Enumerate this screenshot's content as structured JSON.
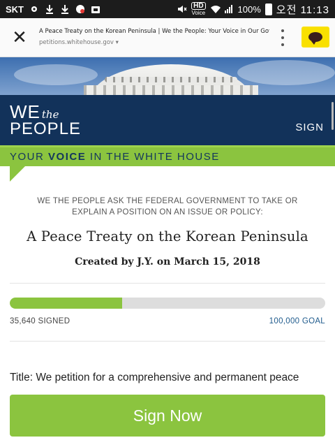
{
  "status_bar": {
    "carrier": "SKT",
    "hd_label": "HD",
    "voice_label": "Voice",
    "battery": "100%",
    "time": "오전 11:13"
  },
  "browser": {
    "page_title": "A Peace Treaty on the Korean Peninsula | We the People: Your Voice in Our Government",
    "domain": "petitions.whitehouse.gov ▾"
  },
  "header": {
    "logo_we": "WE",
    "logo_the": "the",
    "logo_people": "PEOPLE",
    "sign_link": "SIGN",
    "tagline_pre": "YOUR ",
    "tagline_bold": "VOICE",
    "tagline_post": " IN THE WHITE HOUSE"
  },
  "petition": {
    "ask_text": "WE THE PEOPLE ASK THE FEDERAL GOVERNMENT TO TAKE OR EXPLAIN A POSITION ON AN ISSUE OR POLICY:",
    "title": "A Peace Treaty on the Korean Peninsula",
    "created": "Created by J.Y. on March 15, 2018",
    "signed_label": "35,640 SIGNED",
    "goal_label": "100,000 GOAL",
    "signed_count": 35640,
    "goal_count": 100000,
    "progress_fraction": 0.3564,
    "body_excerpt": "Title: We petition for a comprehensive and permanent peace"
  },
  "actions": {
    "sign_now": "Sign Now"
  },
  "colors": {
    "navy": "#12325a",
    "green": "#8bc43f",
    "goal_blue": "#1e5a8c",
    "chat_yellow": "#f9e000"
  }
}
